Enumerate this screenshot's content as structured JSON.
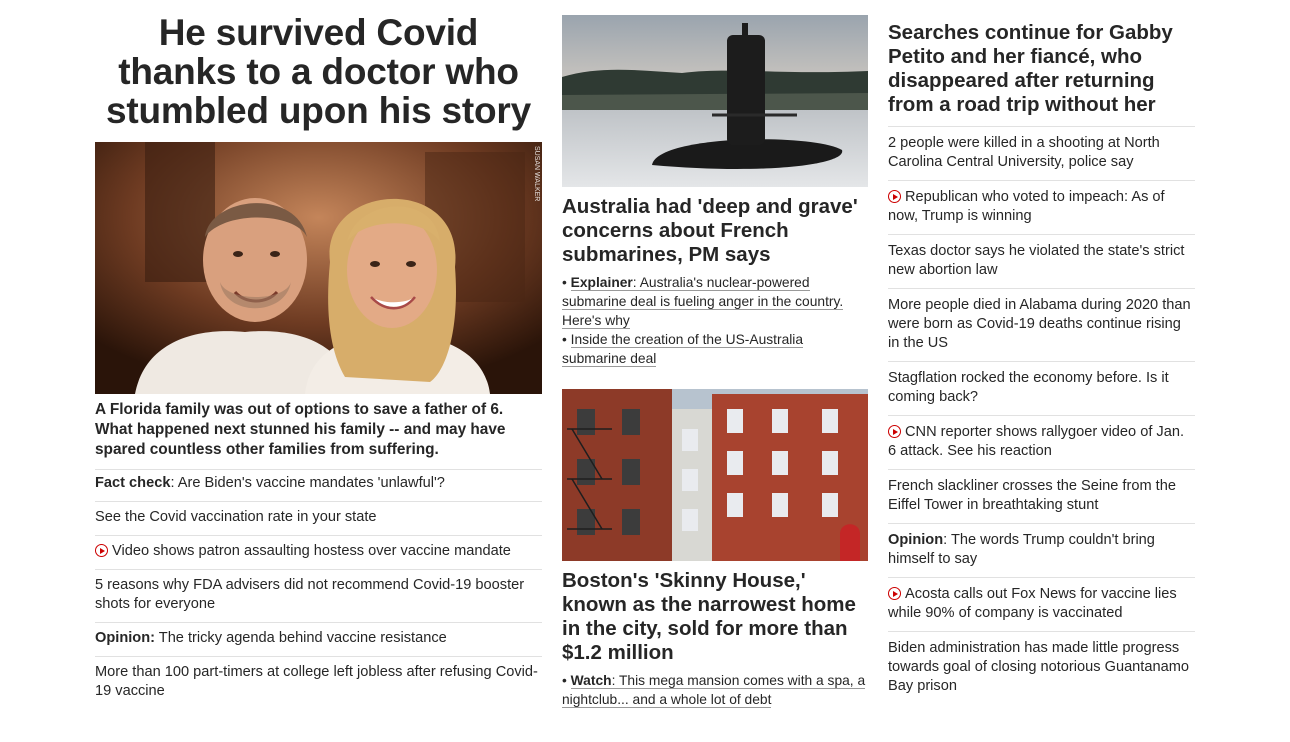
{
  "col1": {
    "hero_title": "He survived Covid thanks to a doctor who stumbled upon his story",
    "photo_credit": "SUSAN WALKER",
    "hero_subtitle": "A Florida family was out of options to save a father of 6. What happened next stunned his family -- and may have spared countless other families from suffering.",
    "items": [
      {
        "prefix": "Fact check",
        "text": ": Are Biden's vaccine mandates 'unlawful'?",
        "video": false
      },
      {
        "prefix": "",
        "text": "See the Covid vaccination rate in your state",
        "video": false
      },
      {
        "prefix": "",
        "text": "Video shows patron assaulting hostess over vaccine mandate",
        "video": true
      },
      {
        "prefix": "",
        "text": "5 reasons why FDA advisers did not recommend Covid-19 booster shots for everyone",
        "video": false
      },
      {
        "prefix": "Opinion:",
        "text": " The tricky agenda behind vaccine resistance",
        "video": false
      },
      {
        "prefix": "",
        "text": "More than 100 part-timers at college left jobless after refusing Covid-19 vaccine",
        "video": false
      }
    ]
  },
  "col2": {
    "story1": {
      "headline": "Australia had 'deep and grave' concerns about French submarines, PM says",
      "bullet1_prefix": "Explainer",
      "bullet1_text": ": Australia's nuclear-powered submarine deal is fueling anger in the country. Here's why",
      "bullet2_text": "Inside the creation of the US-Australia submarine deal"
    },
    "story2": {
      "headline": "Boston's 'Skinny House,' known as the narrowest home in the city, sold for more than $1.2 million",
      "bullet1_prefix": "Watch",
      "bullet1_text": ": This mega mansion comes with a spa, a nightclub... and a whole lot of debt"
    }
  },
  "col3": {
    "headline": "Searches continue for Gabby Petito and her fiancé, who disappeared after returning from a road trip without her",
    "items": [
      {
        "prefix": "",
        "text": "2 people were killed in a shooting at North Carolina Central University, police say",
        "video": false
      },
      {
        "prefix": "",
        "text": "Republican who voted to impeach: As of now, Trump is winning",
        "video": true
      },
      {
        "prefix": "",
        "text": "Texas doctor says he violated the state's strict new abortion law",
        "video": false
      },
      {
        "prefix": "",
        "text": "More people died in Alabama during 2020 than were born as Covid-19 deaths continue rising in the US",
        "video": false
      },
      {
        "prefix": "",
        "text": "Stagflation rocked the economy before. Is it coming back?",
        "video": false
      },
      {
        "prefix": "",
        "text": "CNN reporter shows rallygoer video of Jan. 6 attack. See his reaction",
        "video": true
      },
      {
        "prefix": "",
        "text": "French slackliner crosses the Seine from the Eiffel Tower in breathtaking stunt",
        "video": false
      },
      {
        "prefix": "Opinion",
        "text": ": The words Trump couldn't bring himself to say",
        "video": false
      },
      {
        "prefix": "",
        "text": "Acosta calls out Fox News for vaccine lies while 90% of company is vaccinated",
        "video": true
      },
      {
        "prefix": "",
        "text": "Biden administration has made little progress towards goal of closing notorious Guantanamo Bay prison",
        "video": false
      }
    ]
  },
  "colors": {
    "text": "#262626",
    "divider": "#e1e1e1",
    "video_red": "#cc0000"
  },
  "icons": {
    "video": "play-circle-icon"
  }
}
